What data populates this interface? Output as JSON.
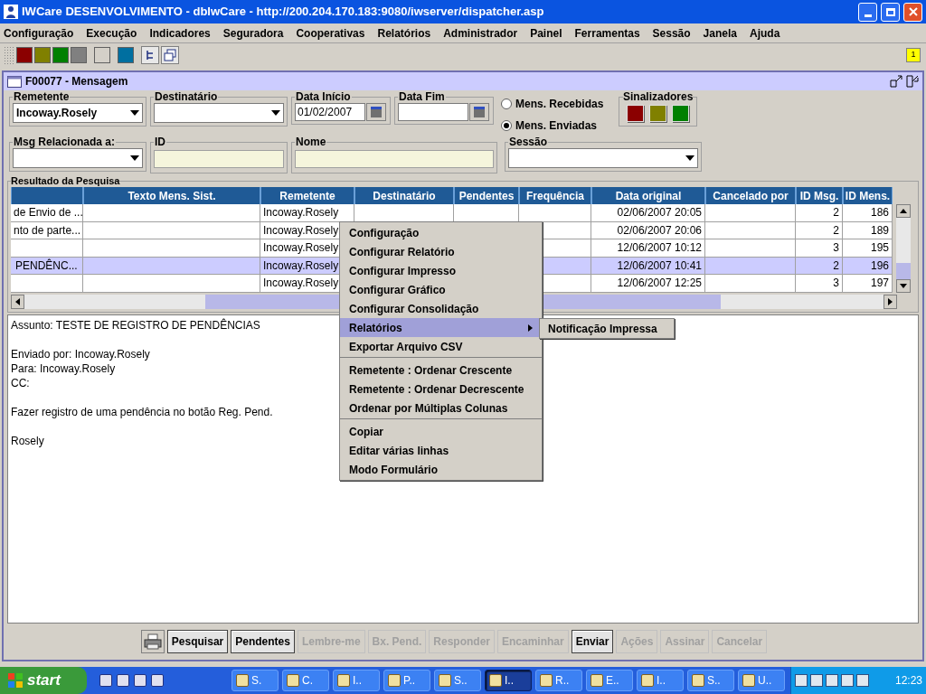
{
  "window": {
    "title": "IWCare DESENVOLVIMENTO - dbIwCare - http://200.204.170.183:9080/iwserver/dispatcher.asp"
  },
  "menu": [
    "Configuração",
    "Execução",
    "Indicadores",
    "Seguradora",
    "Cooperativas",
    "Relatórios",
    "Administrador",
    "Painel",
    "Ferramentas",
    "Sessão",
    "Janela",
    "Ajuda"
  ],
  "toolbar": {
    "swatches": [
      {
        "color": "#8b0000"
      },
      {
        "color": "#808000"
      },
      {
        "color": "#008000"
      },
      {
        "color": "#808080"
      },
      {
        "color": "#d4d0c8"
      },
      {
        "color": "#006fa0"
      }
    ],
    "badge": "1"
  },
  "frame": {
    "title": "F00077 - Mensagem"
  },
  "filters": {
    "remetente": {
      "label": "Remetente",
      "value": "Incoway.Rosely"
    },
    "destinatario": {
      "label": "Destinatário"
    },
    "data_inicio": {
      "label": "Data Início",
      "value": "01/02/2007"
    },
    "data_fim": {
      "label": "Data Fim"
    },
    "radios": [
      {
        "label": "Mens. Recebidas",
        "selected": false
      },
      {
        "label": "Mens. Enviadas",
        "selected": true
      }
    ],
    "sinalizadores": {
      "label": "Sinalizadores",
      "colors": [
        {
          "color": "#8b0000"
        },
        {
          "color": "#808000"
        },
        {
          "color": "#008000"
        }
      ]
    },
    "msg_relacionada": {
      "label": "Msg Relacionada a:"
    },
    "id": {
      "label": "ID"
    },
    "nome": {
      "label": "Nome"
    },
    "sessao": {
      "label": "Sessão"
    }
  },
  "results": {
    "title": "Resultado da Pesquisa",
    "columns": [
      "Texto Mens. Sist.",
      "Remetente",
      "Destinatário",
      "Pendentes",
      "Frequência",
      "Data original",
      "Cancelado por",
      "ID Msg.",
      "ID Mens."
    ],
    "rows": [
      {
        "column_1": "de Envio de ...",
        "remetente": "Incoway.Rosely",
        "data_original": "02/06/2007 20:05",
        "id_msg": "2",
        "id_mens": "186",
        "selected": false
      },
      {
        "column_1": "nto de parte...",
        "remetente": "Incoway.Rosely",
        "data_original": "02/06/2007 20:06",
        "id_msg": "2",
        "id_mens": "189",
        "selected": false
      },
      {
        "remetente": "Incoway.Rosely",
        "data_original": "12/06/2007 10:12",
        "id_msg": "3",
        "id_mens": "195",
        "selected": false
      },
      {
        "column_1": "PENDÊNC...",
        "remetente": "Incoway.Rosely",
        "data_original": "12/06/2007 10:41",
        "id_msg": "2",
        "id_mens": "196",
        "selected": true
      },
      {
        "remetente": "Incoway.Rosely",
        "data_original": "12/06/2007 12:25",
        "id_msg": "3",
        "id_mens": "197",
        "selected": false
      }
    ]
  },
  "context_menu": [
    {
      "kind": "item",
      "label": "Configuração",
      "selected": false
    },
    {
      "kind": "item",
      "label": "Configurar Relatório",
      "selected": false
    },
    {
      "kind": "item",
      "label": "Configurar Impresso",
      "selected": false
    },
    {
      "kind": "item",
      "label": "Configurar Gráfico",
      "selected": false
    },
    {
      "kind": "item",
      "label": "Configurar Consolidação",
      "selected": false
    },
    {
      "kind": "submenu",
      "label": "Relatórios",
      "selected": true,
      "children": [
        {
          "label": "Notificação Impressa"
        }
      ]
    },
    {
      "kind": "item",
      "label": "Exportar Arquivo CSV",
      "selected": false
    },
    {
      "kind": "separator"
    },
    {
      "kind": "item",
      "label": "Remetente : Ordenar Crescente",
      "selected": false
    },
    {
      "kind": "item",
      "label": "Remetente : Ordenar Decrescente",
      "selected": false
    },
    {
      "kind": "item",
      "label": "Ordenar por Múltiplas Colunas",
      "selected": false
    },
    {
      "kind": "separator"
    },
    {
      "kind": "item",
      "label": "Copiar",
      "selected": false
    },
    {
      "kind": "item",
      "label": "Editar várias linhas",
      "selected": false
    },
    {
      "kind": "item",
      "label": "Modo Formulário",
      "selected": false
    }
  ],
  "message": [
    [
      "Assunto: TESTE DE REGISTRO DE PENDÊNCIAS"
    ],
    [
      "Enviado por: Incoway.Rosely",
      "Para: Incoway.Rosely",
      "CC:"
    ],
    [
      "Fazer registro de uma pendência no botão Reg. Pend."
    ],
    [
      "Rosely"
    ]
  ],
  "buttons": [
    {
      "label": "Pesquisar",
      "disabled": false
    },
    {
      "label": "Pendentes",
      "disabled": false
    },
    {
      "label": "Lembre-me",
      "disabled": true
    },
    {
      "label": "Bx. Pend.",
      "disabled": true
    },
    {
      "label": "Responder",
      "disabled": true
    },
    {
      "label": "Encaminhar",
      "disabled": true
    },
    {
      "label": "Enviar",
      "disabled": false
    },
    {
      "label": "Ações",
      "disabled": true
    },
    {
      "label": "Assinar",
      "disabled": true
    },
    {
      "label": "Cancelar",
      "disabled": true
    }
  ],
  "taskbar": {
    "start": "start",
    "tasks": [
      {
        "label": "S.",
        "selected": false
      },
      {
        "label": "C.",
        "selected": false
      },
      {
        "label": "I..",
        "selected": false
      },
      {
        "label": "P..",
        "selected": false
      },
      {
        "label": "S..",
        "selected": false
      },
      {
        "label": "I..",
        "selected": true
      },
      {
        "label": "R..",
        "selected": false
      },
      {
        "label": "E..",
        "selected": false
      },
      {
        "label": "I..",
        "selected": false
      },
      {
        "label": "S..",
        "selected": false
      },
      {
        "label": "U..",
        "selected": false
      }
    ],
    "clock": "12:23"
  }
}
